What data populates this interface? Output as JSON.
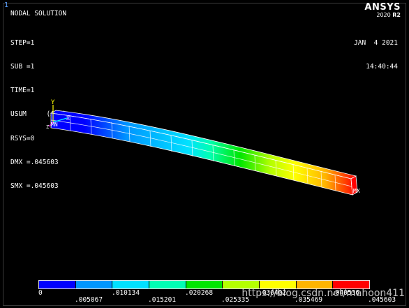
{
  "window": {
    "number": "1"
  },
  "brand": {
    "name": "ANSYS",
    "version": "2020",
    "release": "R2"
  },
  "header": {
    "title": "NODAL SOLUTION",
    "info_lines": [
      "STEP=1",
      "SUB =1",
      "TIME=1",
      "USUM     (AVG)",
      "RSYS=0",
      "DMX =.045603",
      "SMX =.045603"
    ],
    "date": "JAN  4 2021",
    "time": "14:40:44"
  },
  "axes": {
    "y": "Y",
    "x": "X",
    "z": "Z",
    "mn": "MN",
    "mx": "MX"
  },
  "legend": {
    "colors": [
      "#0000ff",
      "#0096ff",
      "#00e1ff",
      "#00ffb4",
      "#00e600",
      "#b4ff00",
      "#ffff00",
      "#ffb400",
      "#ff0000"
    ],
    "top_labels": [
      "0",
      ".010134",
      ".020268",
      ".030402",
      ".040536"
    ],
    "bottom_labels": [
      ".005067",
      ".015201",
      ".025335",
      ".035469",
      ".045603"
    ]
  },
  "watermark": "https://blog.csdn.net/mahoon411"
}
